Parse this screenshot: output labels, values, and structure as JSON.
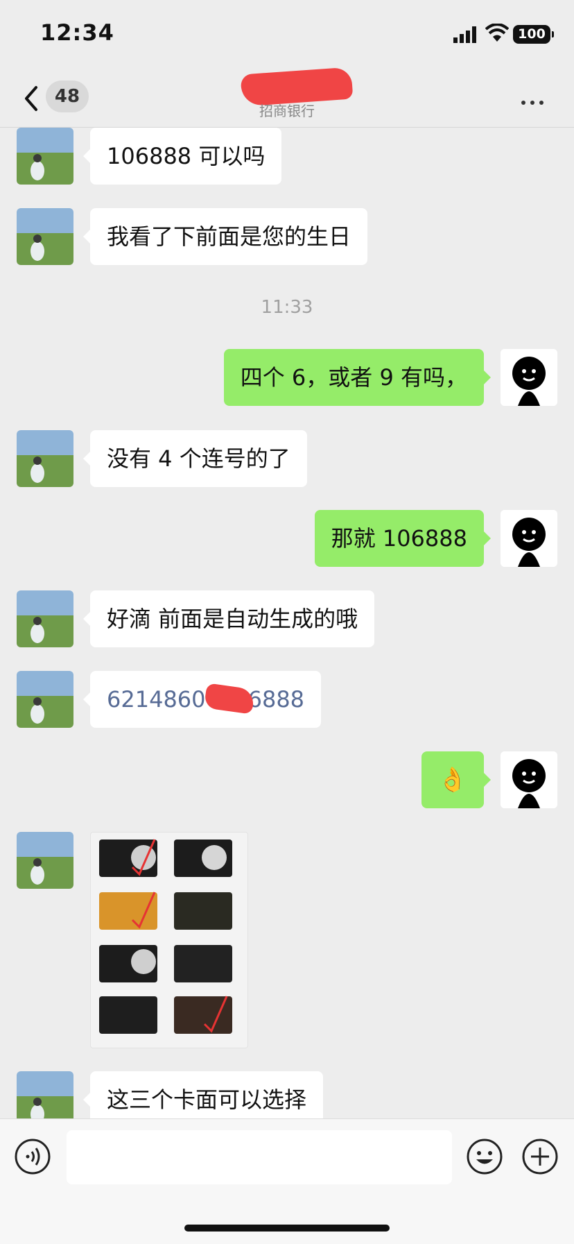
{
  "status_bar": {
    "time": "12:34",
    "battery": "100"
  },
  "header": {
    "unread_count": "48",
    "subtitle": "招商银行"
  },
  "messages": [
    {
      "side": "in",
      "text": "106888 可以吗"
    },
    {
      "side": "in",
      "text": "我看了下前面是您的生日"
    },
    {
      "timestamp": "11:33"
    },
    {
      "side": "out",
      "text": "四个 6，或者 9 有吗，"
    },
    {
      "side": "in",
      "text": "没有 4 个连号的了"
    },
    {
      "side": "out",
      "text": "那就 106888"
    },
    {
      "side": "in",
      "text": "好滴 前面是自动生成的哦"
    },
    {
      "side": "in",
      "text": "62148600106888",
      "prefix": "621486",
      "suffix": "0106888"
    },
    {
      "side": "out",
      "text": "👌"
    },
    {
      "side": "in",
      "image": "bank-card-designs"
    },
    {
      "side": "in",
      "text": "这三个卡面可以选择"
    }
  ],
  "input": {
    "placeholder": ""
  },
  "colors": {
    "outgoing_bubble": "#95ec69",
    "link": "#576b95",
    "background": "#ededed"
  }
}
